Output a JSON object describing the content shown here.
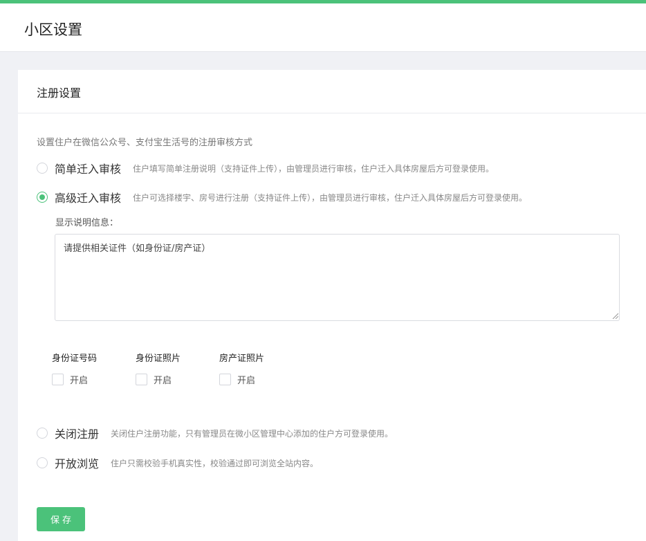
{
  "header": {
    "title": "小区设置"
  },
  "card": {
    "title": "注册设置"
  },
  "section": {
    "description": "设置住户在微信公众号、支付宝生活号的注册审核方式",
    "options": [
      {
        "label": "简单迁入审核",
        "hint": "住户填写简单注册说明（支持证件上传），由管理员进行审核，住户迁入具体房屋后方可登录使用。",
        "selected": false
      },
      {
        "label": "高级迁入审核",
        "hint": "住户可选择楼宇、房号进行注册（支持证件上传），由管理员进行审核，住户迁入具体房屋后方可登录使用。",
        "selected": true
      },
      {
        "label": "关闭注册",
        "hint": "关闭住户注册功能，只有管理员在微小区管理中心添加的住户方可登录使用。",
        "selected": false
      },
      {
        "label": "开放浏览",
        "hint": "住户只需校验手机真实性，校验通过即可浏览全站内容。",
        "selected": false
      }
    ],
    "info_label": "显示说明信息：",
    "info_text": "请提供相关证件（如身份证/房产证）",
    "checks": [
      {
        "title": "身份证号码",
        "label": "开启",
        "checked": false
      },
      {
        "title": "身份证照片",
        "label": "开启",
        "checked": false
      },
      {
        "title": "房产证照片",
        "label": "开启",
        "checked": false
      }
    ]
  },
  "actions": {
    "save_label": "保存"
  },
  "colors": {
    "accent": "#4bc27a",
    "background": "#f0f1f5"
  }
}
